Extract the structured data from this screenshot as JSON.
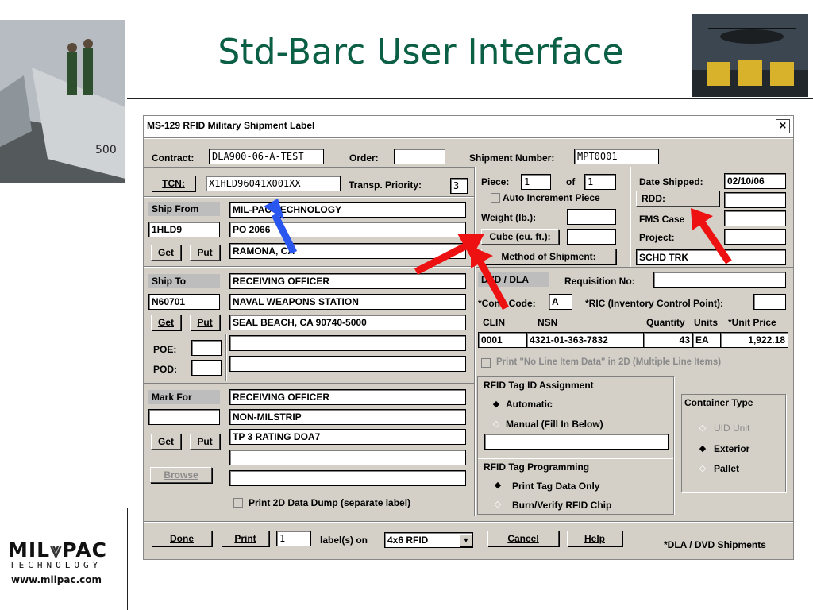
{
  "slide": {
    "title": "Std-Barc User Interface",
    "logo_text": "MIL",
    "logo_text2": "PAC",
    "logo_subtext": "TECHNOLOGY",
    "logo_url": "www.milpac.com",
    "photo_left_text": "500"
  },
  "dialog": {
    "title": "MS-129 RFID Military Shipment Label",
    "close_label": "×",
    "contract_label": "Contract:",
    "contract_value": "DLA900-06-A-TEST",
    "order_label": "Order:",
    "order_value": "",
    "shipment_number_label": "Shipment Number:",
    "shipment_number_value": "MPT0001",
    "tcn_button": "TCN:",
    "tcn_value": "X1HLD96041X001XX",
    "transp_priority_label": "Transp. Priority:",
    "transp_priority_value": "3",
    "piece_label": "Piece:",
    "piece_value": "1",
    "of_label": "of",
    "of_value": "1",
    "auto_increment_label": "Auto Increment Piece",
    "weight_label": "Weight (lb.):",
    "weight_value": "",
    "cube_button": "Cube (cu. ft.):",
    "cube_value": "",
    "method_button": "Method of Shipment:",
    "method_value": "SCHD TRK",
    "date_shipped_label": "Date Shipped:",
    "date_shipped_value": "02/10/06",
    "rdd_button": "RDD:",
    "rdd_value": "",
    "fms_case_label": "FMS Case",
    "fms_case_value": "",
    "project_label": "Project:",
    "project_value": "",
    "ship_from": {
      "header": "Ship From",
      "code": "1HLD9",
      "lines": [
        "MIL-PAC TECHNOLOGY",
        "PO 2066",
        "RAMONA, CA"
      ],
      "get_label": "Get",
      "put_label": "Put"
    },
    "ship_to": {
      "header": "Ship To",
      "code": "N60701",
      "lines": [
        "RECEIVING OFFICER",
        "NAVAL WEAPONS STATION",
        "SEAL BEACH,  CA  90740-5000",
        ""
      ],
      "get_label": "Get",
      "put_label": "Put"
    },
    "poe_label": "POE:",
    "poe_value": "",
    "pod_label": "POD:",
    "pod_value": "",
    "mark_for": {
      "header": "Mark For",
      "code": "",
      "lines": [
        "RECEIVING OFFICER",
        "NON-MILSTRIP",
        "TP 3 RATING DOA7",
        "",
        ""
      ],
      "get_label": "Get",
      "put_label": "Put"
    },
    "browse_label": "Browse",
    "print_2d_label": "Print 2D Data Dump (separate label)",
    "dvd_dla_header": "DVD / DLA",
    "requisition_label": "Requisition No:",
    "requisition_value": "",
    "cond_code_label": "*Cond Code:",
    "cond_code_value": "A",
    "ric_label": "*RIC (Inventory Control Point):",
    "ric_value": "",
    "table_headers": [
      "CLIN",
      "NSN",
      "Quantity",
      "Units",
      "*Unit Price"
    ],
    "table_row": [
      "0001",
      "4321-01-363-7832",
      "43",
      "EA",
      "1,922.18"
    ],
    "print_no_line_label": "Print \"No Line Item Data\" in 2D (Multiple Line Items)",
    "rfid_assign_header": "RFID Tag ID Assignment",
    "automatic_label": "Automatic",
    "manual_label": "Manual (Fill In Below)",
    "manual_value": "",
    "rfid_prog_header": "RFID Tag Programming",
    "print_tag_label": "Print Tag Data Only",
    "burn_verify_label": "Burn/Verify RFID Chip",
    "container_type_header": "Container Type",
    "uid_unit_label": "UID Unit",
    "exterior_label": "Exterior",
    "pallet_label": "Pallet",
    "done_label": "Done",
    "print_label": "Print",
    "label_count_value": "1",
    "labels_on_label": "label(s) on",
    "label_type_value": "4x6 RFID",
    "cancel_label": "Cancel",
    "help_label": "Help",
    "footnote": "*DLA / DVD Shipments"
  },
  "colors": {
    "title_green": "#0b5f45",
    "arrow_red": "#ee1111",
    "arrow_blue": "#2a56f0"
  }
}
